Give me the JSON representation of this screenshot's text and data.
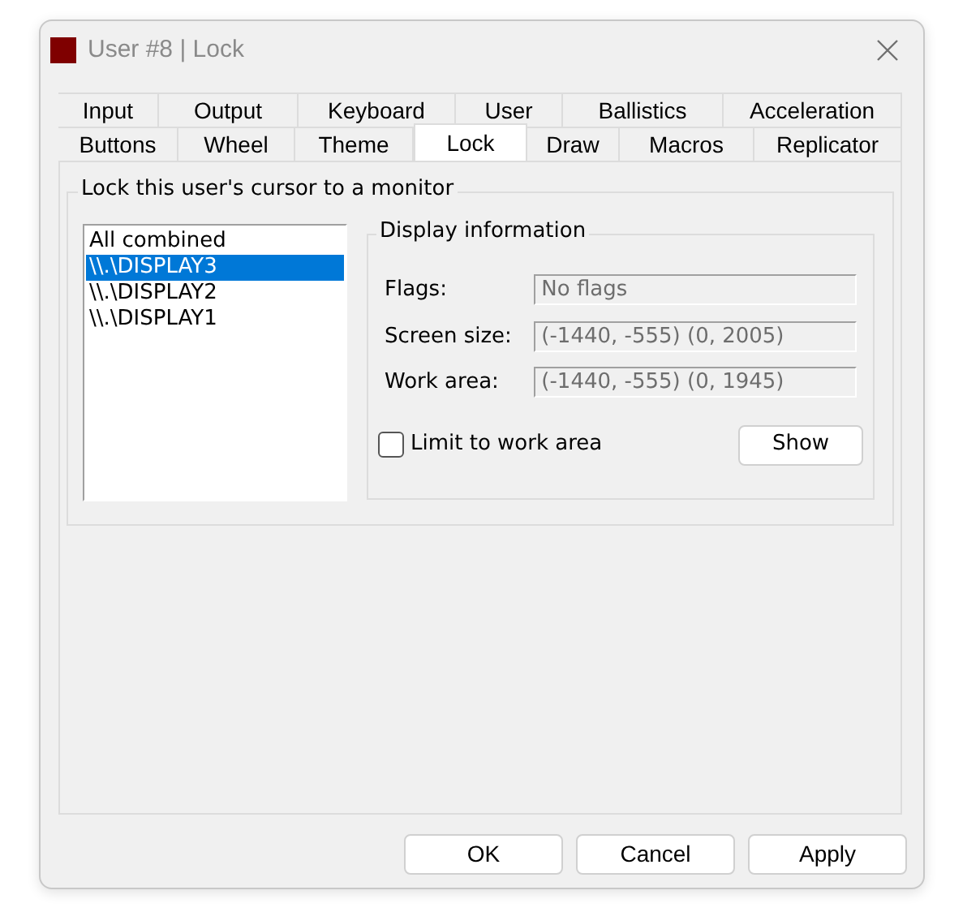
{
  "window": {
    "title": "User #8 | Lock"
  },
  "tab_rows": [
    [
      {
        "label": "Input",
        "selected": false
      },
      {
        "label": "Output",
        "selected": false
      },
      {
        "label": "Keyboard",
        "selected": false
      },
      {
        "label": "User",
        "selected": false
      },
      {
        "label": "Ballistics",
        "selected": false
      },
      {
        "label": "Acceleration",
        "selected": false
      }
    ],
    [
      {
        "label": "Buttons",
        "selected": false
      },
      {
        "label": "Wheel",
        "selected": false
      },
      {
        "label": "Theme",
        "selected": false
      },
      {
        "label": "Lock",
        "selected": true
      },
      {
        "label": "Draw",
        "selected": false
      },
      {
        "label": "Macros",
        "selected": false
      },
      {
        "label": "Replicator",
        "selected": false
      }
    ]
  ],
  "lock_group": {
    "title": "Lock this user's cursor to a monitor",
    "monitors": [
      {
        "label": "All combined",
        "selected": false
      },
      {
        "label": "\\\\.\\DISPLAY3",
        "selected": true
      },
      {
        "label": "\\\\.\\DISPLAY2",
        "selected": false
      },
      {
        "label": "\\\\.\\DISPLAY1",
        "selected": false
      }
    ],
    "display_info": {
      "title": "Display information",
      "fields": [
        {
          "label": "Flags:",
          "value": "No flags"
        },
        {
          "label": "Screen size:",
          "value": "(-1440, -555) (0, 2005)"
        },
        {
          "label": "Work area:",
          "value": "(-1440, -555) (0, 1945)"
        }
      ],
      "limit_checkbox": {
        "label": "Limit to work area",
        "checked": false
      },
      "show_button": "Show"
    }
  },
  "buttons": [
    "OK",
    "Cancel",
    "Apply"
  ]
}
